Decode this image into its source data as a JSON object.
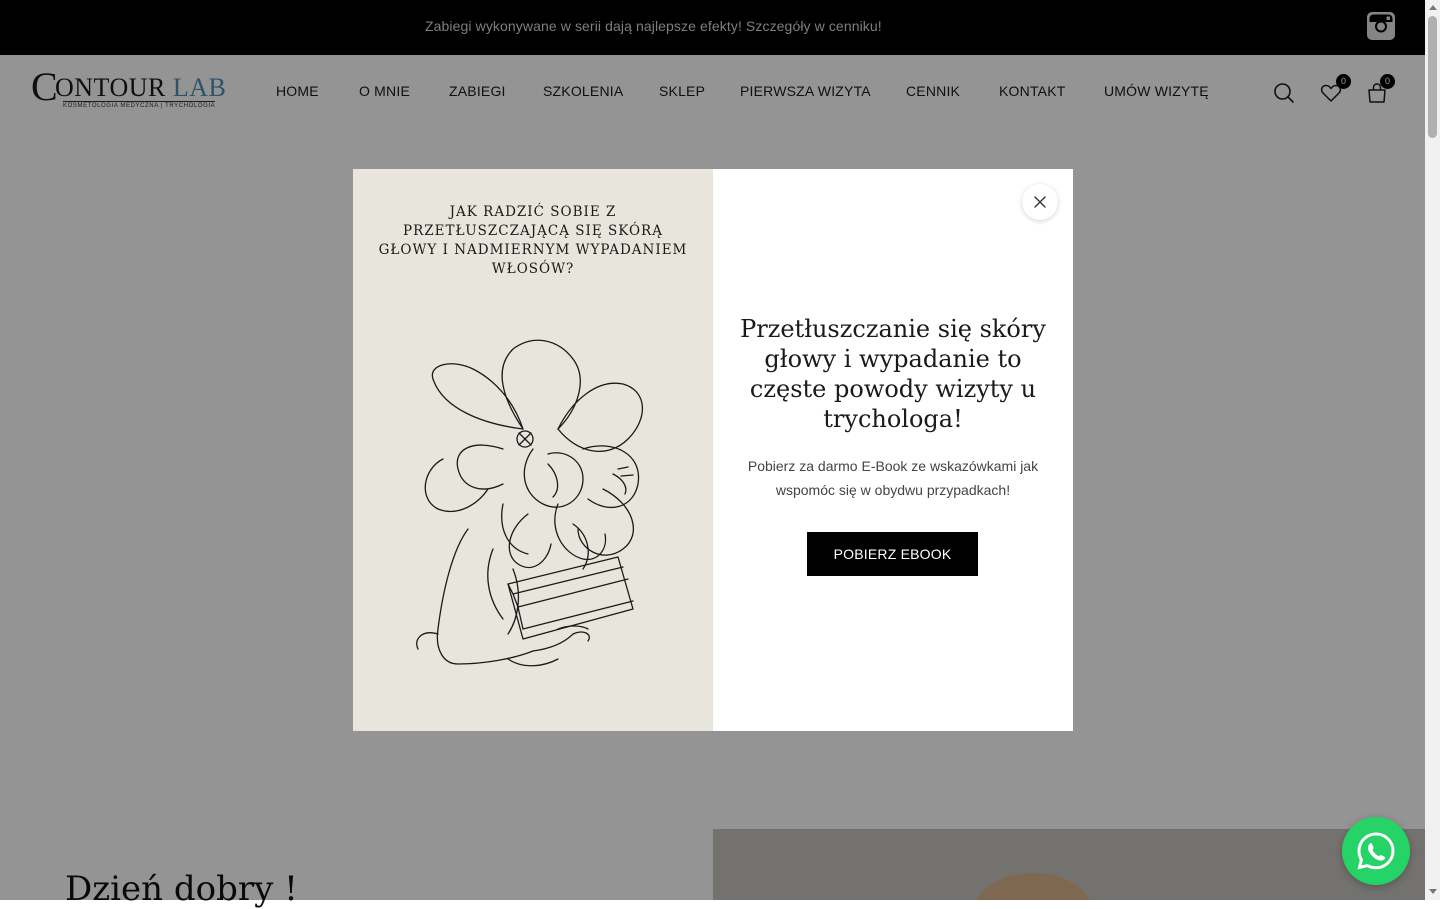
{
  "topbar": {
    "promo_text": "Zabiegi wykonywane w serii dają najlepsze efekty! Szczegóły w cenniku!",
    "social_icon": "instagram-icon"
  },
  "header": {
    "logo": {
      "main_text": "ONTOUR",
      "accent_text": "LAB",
      "subtitle": "KOSMETOLOGIA MEDYCZNA | TRYCHOLOGIA"
    },
    "nav": [
      {
        "label": "HOME"
      },
      {
        "label": "O MNIE"
      },
      {
        "label": "ZABIEGI"
      },
      {
        "label": "SZKOLENIA"
      },
      {
        "label": "SKLEP"
      },
      {
        "label": "PIERWSZA WIZYTA"
      },
      {
        "label": "CENNIK"
      },
      {
        "label": "KONTAKT"
      },
      {
        "label": "UMÓW WIZYTĘ"
      }
    ],
    "icons": {
      "search": "search-icon",
      "wishlist": "heart-icon",
      "cart": "cart-icon"
    },
    "wishlist_count": "0",
    "cart_count": "0"
  },
  "page": {
    "greeting": "Dzień dobry !"
  },
  "modal": {
    "left_title": "JAK RADZIĆ SOBIE Z PRZETŁUSZCZAJĄCĄ SIĘ SKÓRĄ GŁOWY I NADMIERNYM WYPADANIEM WŁOSÓW?",
    "heading": "Przetłuszczanie się skóry głowy i wypadanie to częste powody wizyty u trychologa!",
    "text": "Pobierz za darmo E-Book ze wskazówkami jak wspomóc się w obydwu przypadkach!",
    "cta_label": "POBIERZ EBOOK",
    "close_icon": "close-icon"
  },
  "colors": {
    "topbar_bg": "#000000",
    "overlay": "rgba(0,0,0,0.42)",
    "modal_left_bg": "#e8e5dc",
    "logo_accent": "#4a90b8",
    "whatsapp": "#25d366"
  }
}
